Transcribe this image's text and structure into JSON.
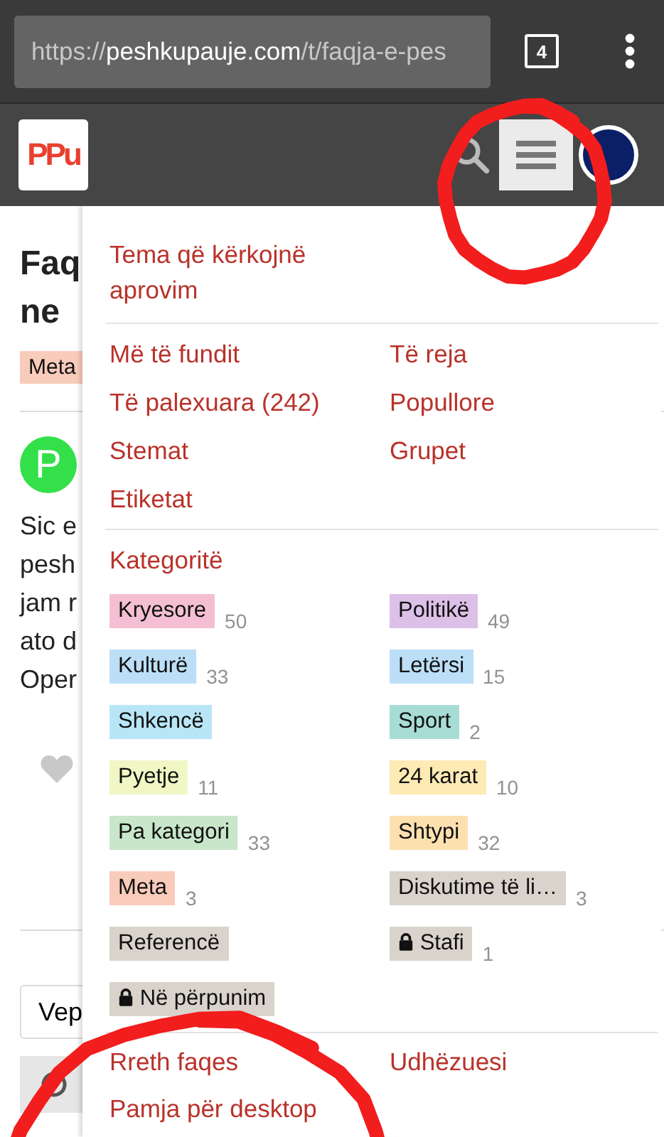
{
  "browser": {
    "url": {
      "scheme": "https://",
      "host": "peshkupauje.com",
      "path": "/t/faqja-e-pes"
    },
    "tab_count": "4"
  },
  "header": {
    "logo": "PPu",
    "menu_button": {
      "expanded": true,
      "circled": true
    }
  },
  "page": {
    "title_lines": [
      "Faq",
      "ne"
    ],
    "tag": "Meta",
    "avatar_letter": "P",
    "post_lines": [
      "Sic e",
      "pesh",
      "jam r",
      "ato d",
      "Oper"
    ],
    "button": "Vep"
  },
  "menu": {
    "top_links": [
      {
        "label": "Tema që kërkojnë aprovim"
      }
    ],
    "links": [
      {
        "label": "Më të fundit"
      },
      {
        "label": "Të reja"
      },
      {
        "label": "Të palexuara (242)"
      },
      {
        "label": "Popullore"
      },
      {
        "label": "Stemat"
      },
      {
        "label": "Grupet"
      },
      {
        "label": "Etiketat"
      }
    ],
    "categories_title": "Kategoritë",
    "categories": [
      {
        "name": "Kryesore",
        "count": "50",
        "color": "#f4bfd3",
        "locked": false
      },
      {
        "name": "Politikë",
        "count": "49",
        "color": "#dcc0e8",
        "locked": false
      },
      {
        "name": "Kulturë",
        "count": "33",
        "color": "#bcdff7",
        "locked": false
      },
      {
        "name": "Letërsi",
        "count": "15",
        "color": "#bcdff7",
        "locked": false
      },
      {
        "name": "Shkencë",
        "color": "#b9e6f7",
        "locked": false
      },
      {
        "name": "Sport",
        "count": "2",
        "color": "#a7ddd5",
        "locked": false
      },
      {
        "name": "Pyetje",
        "count": "11",
        "color": "#f0f6c4",
        "locked": false
      },
      {
        "name": "24 karat",
        "count": "10",
        "color": "#fdeab4",
        "locked": false
      },
      {
        "name": "Pa kategori",
        "count": "33",
        "color": "#c8e6c9",
        "locked": false
      },
      {
        "name": "Shtypi",
        "count": "32",
        "color": "#fde0b0",
        "locked": false
      },
      {
        "name": "Meta",
        "count": "3",
        "color": "#f9cbbb",
        "locked": false
      },
      {
        "name": "Diskutime të li…",
        "count": "3",
        "color": "#d9d3cb",
        "locked": false
      },
      {
        "name": "Referencë",
        "color": "#d9d3cb",
        "locked": false
      },
      {
        "name": "Stafi",
        "count": "1",
        "color": "#d9d3cb",
        "locked": true
      },
      {
        "name": "Në përpunim",
        "color": "#d9d3cb",
        "locked": true
      }
    ],
    "footer_links": [
      {
        "label": "Rreth faqes"
      },
      {
        "label": "Udhëzuesi"
      },
      {
        "label": "Pamja për desktop"
      }
    ],
    "footer_circled": true
  }
}
